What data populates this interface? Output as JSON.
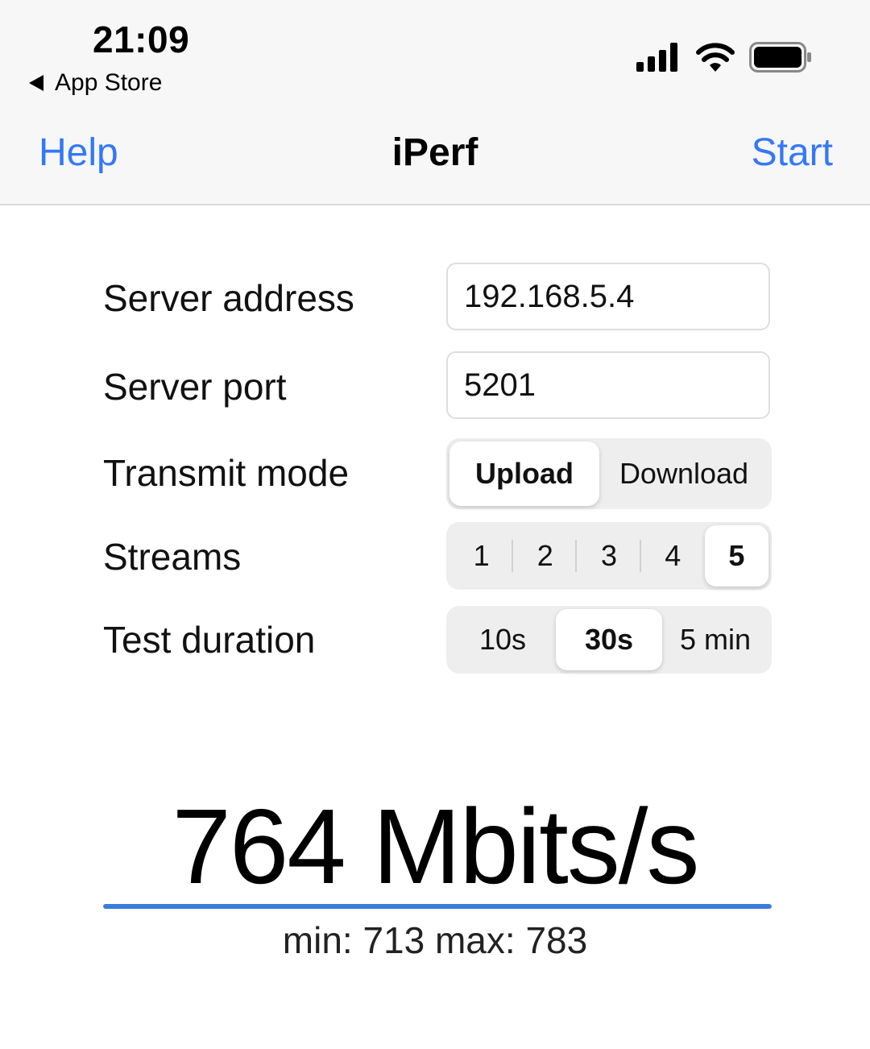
{
  "status_bar": {
    "time": "21:09",
    "back_label": "App Store",
    "icons": [
      "signal-icon",
      "wifi-icon",
      "battery-icon"
    ]
  },
  "nav": {
    "left": "Help",
    "title": "iPerf",
    "right": "Start",
    "accent_color": "#3478f6"
  },
  "form": {
    "server_address": {
      "label": "Server address",
      "value": "192.168.5.4"
    },
    "server_port": {
      "label": "Server port",
      "value": "5201"
    },
    "transmit_mode": {
      "label": "Transmit mode",
      "options": [
        "Upload",
        "Download"
      ],
      "selected": "Upload"
    },
    "streams": {
      "label": "Streams",
      "options": [
        "1",
        "2",
        "3",
        "4",
        "5"
      ],
      "selected": "5"
    },
    "test_duration": {
      "label": "Test duration",
      "options": [
        "10s",
        "30s",
        "5 min"
      ],
      "selected": "30s"
    }
  },
  "result": {
    "speed": "764 Mbits/s",
    "minmax": "min: 713 max: 783",
    "progress": 1.0,
    "progress_color": "#3a7ddb"
  }
}
